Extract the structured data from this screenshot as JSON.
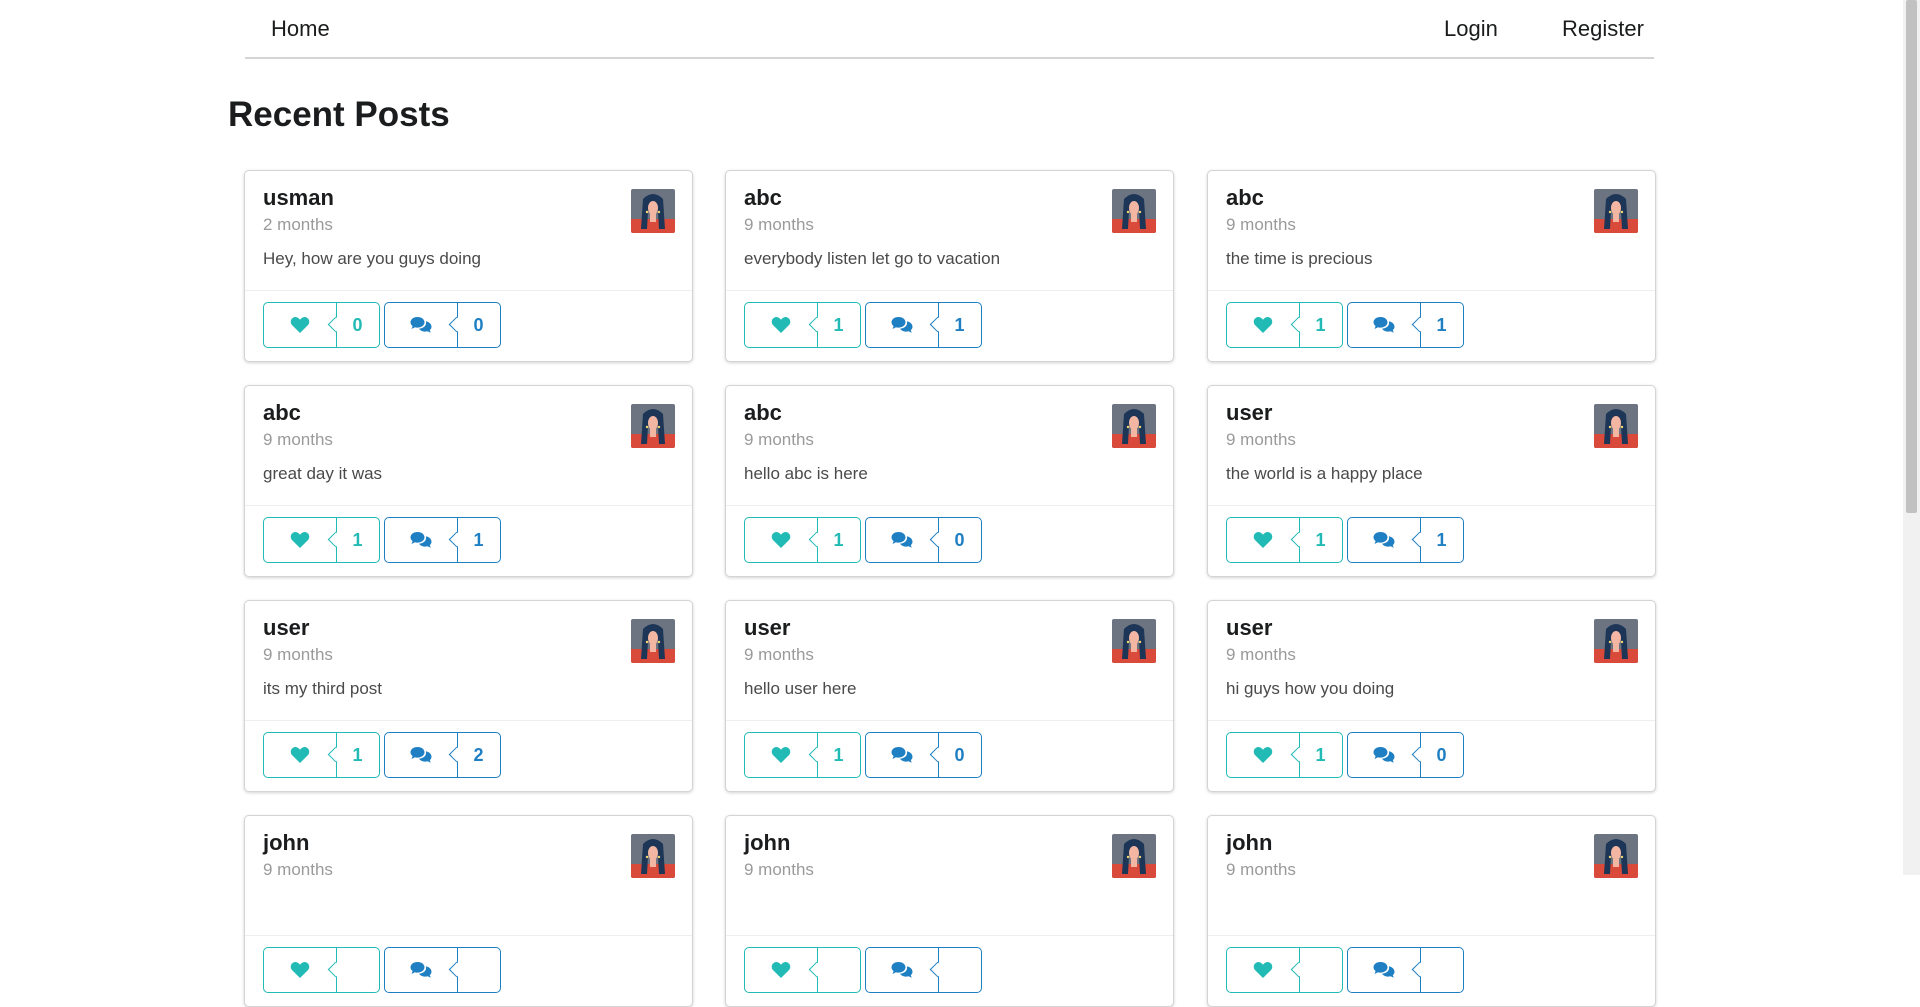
{
  "nav": {
    "home": "Home",
    "login": "Login",
    "register": "Register"
  },
  "page_title": "Recent Posts",
  "colors": {
    "like": "#21bab5",
    "comment": "#1f7fc3",
    "text": "#1b1c1d",
    "meta": "#9a9a9a"
  },
  "icons": {
    "like": "heart-icon",
    "comment": "comments-icon",
    "avatar": "user-avatar-image"
  },
  "posts": [
    {
      "username": "usman",
      "time": "2 months",
      "body": "Hey, how are you guys doing",
      "likes": "0",
      "comments": "0"
    },
    {
      "username": "abc",
      "time": "9 months",
      "body": "everybody listen let go to vacation",
      "likes": "1",
      "comments": "1"
    },
    {
      "username": "abc",
      "time": "9 months",
      "body": "the time is precious",
      "likes": "1",
      "comments": "1"
    },
    {
      "username": "abc",
      "time": "9 months",
      "body": "great day it was",
      "likes": "1",
      "comments": "1"
    },
    {
      "username": "abc",
      "time": "9 months",
      "body": "hello abc is here",
      "likes": "1",
      "comments": "0"
    },
    {
      "username": "user",
      "time": "9 months",
      "body": "the world is a happy place",
      "likes": "1",
      "comments": "1"
    },
    {
      "username": "user",
      "time": "9 months",
      "body": "its my third post",
      "likes": "1",
      "comments": "2"
    },
    {
      "username": "user",
      "time": "9 months",
      "body": "hello user here",
      "likes": "1",
      "comments": "0"
    },
    {
      "username": "user",
      "time": "9 months",
      "body": "hi guys how you doing",
      "likes": "1",
      "comments": "0"
    },
    {
      "username": "john",
      "time": "9 months",
      "body": "",
      "likes": "",
      "comments": ""
    },
    {
      "username": "john",
      "time": "9 months",
      "body": "",
      "likes": "",
      "comments": ""
    },
    {
      "username": "john",
      "time": "9 months",
      "body": "",
      "likes": "",
      "comments": ""
    }
  ]
}
